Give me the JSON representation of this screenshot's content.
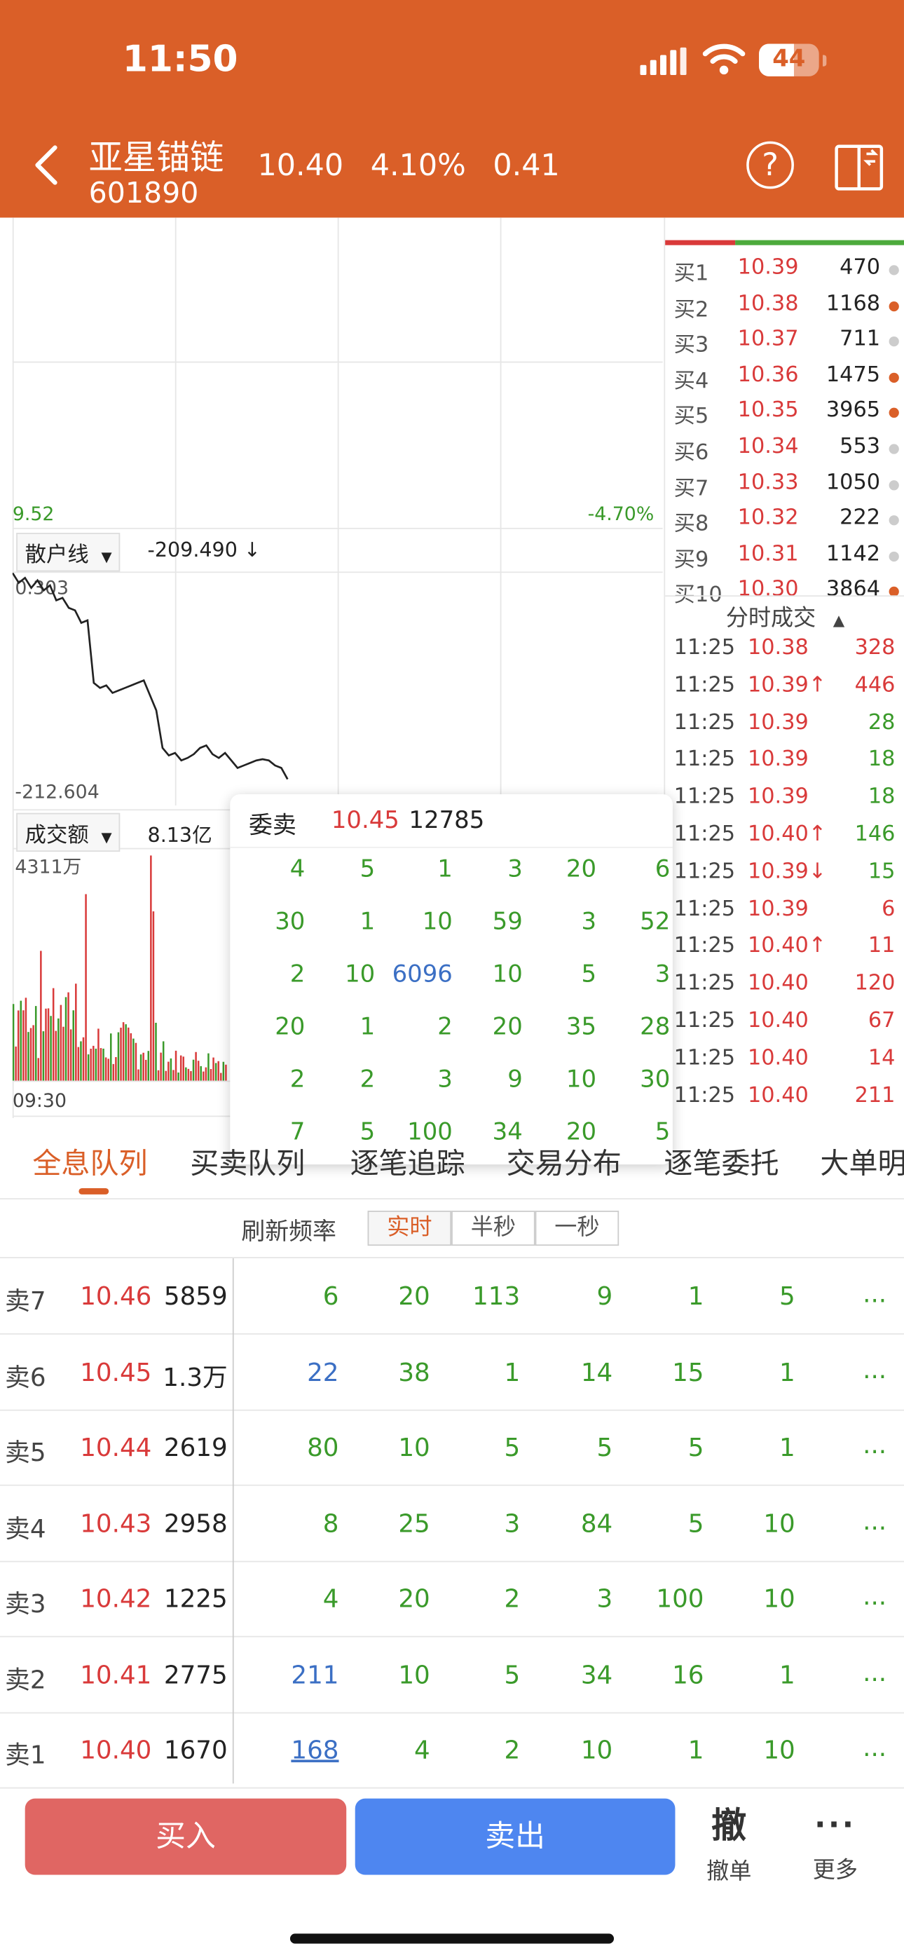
{
  "status_bar": {
    "time": "11:50",
    "battery": "44"
  },
  "header": {
    "stock_name": "亚星锚链",
    "stock_code": "601890",
    "price": "10.40",
    "change_pct": "4.10%",
    "change": "0.41",
    "help": "?"
  },
  "chart": {
    "low_price": "9.52",
    "low_pct": "-4.70%",
    "indicator1": {
      "name": "散户线",
      "value": "-209.490 ↓",
      "max": "0.303",
      "min": "-212.604"
    },
    "indicator2": {
      "name": "成交额",
      "value": "8.13亿",
      "max": "4311万",
      "time_start": "09:30"
    }
  },
  "order_book": {
    "bids": [
      {
        "label": "买1",
        "price": "10.39",
        "vol": "470"
      },
      {
        "label": "买2",
        "price": "10.38",
        "vol": "1168"
      },
      {
        "label": "买3",
        "price": "10.37",
        "vol": "711"
      },
      {
        "label": "买4",
        "price": "10.36",
        "vol": "1475"
      },
      {
        "label": "买5",
        "price": "10.35",
        "vol": "3965"
      },
      {
        "label": "买6",
        "price": "10.34",
        "vol": "553"
      },
      {
        "label": "买7",
        "price": "10.33",
        "vol": "1050"
      },
      {
        "label": "买8",
        "price": "10.32",
        "vol": "222"
      },
      {
        "label": "买9",
        "price": "10.31",
        "vol": "1142"
      },
      {
        "label": "买10",
        "price": "10.30",
        "vol": "3864"
      }
    ],
    "ticks_title": "分时成交",
    "ticks": [
      {
        "time": "11:25",
        "price": "10.38",
        "vol": "328",
        "color": "red"
      },
      {
        "time": "11:25",
        "price": "10.39↑",
        "vol": "446",
        "color": "red"
      },
      {
        "time": "11:25",
        "price": "10.39",
        "vol": "28",
        "color": "green"
      },
      {
        "time": "11:25",
        "price": "10.39",
        "vol": "18",
        "color": "green"
      },
      {
        "time": "11:25",
        "price": "10.39",
        "vol": "18",
        "color": "green"
      },
      {
        "time": "11:25",
        "price": "10.40↑",
        "vol": "146",
        "color": "green"
      },
      {
        "time": "11:25",
        "price": "10.39↓",
        "vol": "15",
        "color": "green"
      },
      {
        "time": "11:25",
        "price": "10.39",
        "vol": "6",
        "color": "red"
      },
      {
        "time": "11:25",
        "price": "10.40↑",
        "vol": "11",
        "color": "red"
      },
      {
        "time": "11:25",
        "price": "10.40",
        "vol": "120",
        "color": "red"
      },
      {
        "time": "11:25",
        "price": "10.40",
        "vol": "67",
        "color": "red"
      },
      {
        "time": "11:25",
        "price": "10.40",
        "vol": "14",
        "color": "red"
      },
      {
        "time": "11:25",
        "price": "10.40",
        "vol": "211",
        "color": "red"
      }
    ]
  },
  "popup": {
    "label": "委卖",
    "price": "10.45",
    "volume": "12785",
    "rows": [
      [
        "4",
        "5",
        "1",
        "3",
        "20",
        "6"
      ],
      [
        "30",
        "1",
        "10",
        "59",
        "3",
        "52"
      ],
      [
        "2",
        "10",
        "6096",
        "10",
        "5",
        "3"
      ],
      [
        "20",
        "1",
        "2",
        "20",
        "35",
        "28"
      ],
      [
        "2",
        "2",
        "3",
        "9",
        "10",
        "30"
      ],
      [
        "7",
        "5",
        "100",
        "34",
        "20",
        "5"
      ]
    ]
  },
  "tabs": [
    "全息队列",
    "买卖队列",
    "逐笔追踪",
    "交易分布",
    "逐笔委托",
    "大单明细"
  ],
  "refresh": {
    "label": "刷新频率",
    "options": [
      "实时",
      "半秒",
      "一秒"
    ]
  },
  "queue": [
    {
      "label": "卖7",
      "price": "10.46",
      "vol": "5859",
      "cells": [
        "6",
        "20",
        "113",
        "9",
        "1",
        "5"
      ],
      "more": "..."
    },
    {
      "label": "卖6",
      "price": "10.45",
      "vol": "1.3万",
      "cells": [
        "22",
        "38",
        "1",
        "14",
        "15",
        "1"
      ],
      "more": "..."
    },
    {
      "label": "卖5",
      "price": "10.44",
      "vol": "2619",
      "cells": [
        "80",
        "10",
        "5",
        "5",
        "5",
        "1"
      ],
      "more": "..."
    },
    {
      "label": "卖4",
      "price": "10.43",
      "vol": "2958",
      "cells": [
        "8",
        "25",
        "3",
        "84",
        "5",
        "10"
      ],
      "more": "..."
    },
    {
      "label": "卖3",
      "price": "10.42",
      "vol": "1225",
      "cells": [
        "4",
        "20",
        "2",
        "3",
        "100",
        "10"
      ],
      "more": "..."
    },
    {
      "label": "卖2",
      "price": "10.41",
      "vol": "2775",
      "cells": [
        "211",
        "10",
        "5",
        "34",
        "16",
        "1"
      ],
      "more": "..."
    },
    {
      "label": "卖1",
      "price": "10.40",
      "vol": "1670",
      "cells": [
        "168",
        "4",
        "2",
        "10",
        "1",
        "10"
      ],
      "more": "..."
    }
  ],
  "bottom": {
    "buy": "买入",
    "sell": "卖出",
    "cancel_icon": "撤",
    "cancel": "撤单",
    "more": "更多"
  },
  "colors": {
    "brand": "#DA5F28",
    "red": "#d93a3a",
    "green": "#3a9a2a",
    "blue": "#3b6fc4",
    "buy_btn": "#E06663",
    "sell_btn": "#4E86F0"
  }
}
